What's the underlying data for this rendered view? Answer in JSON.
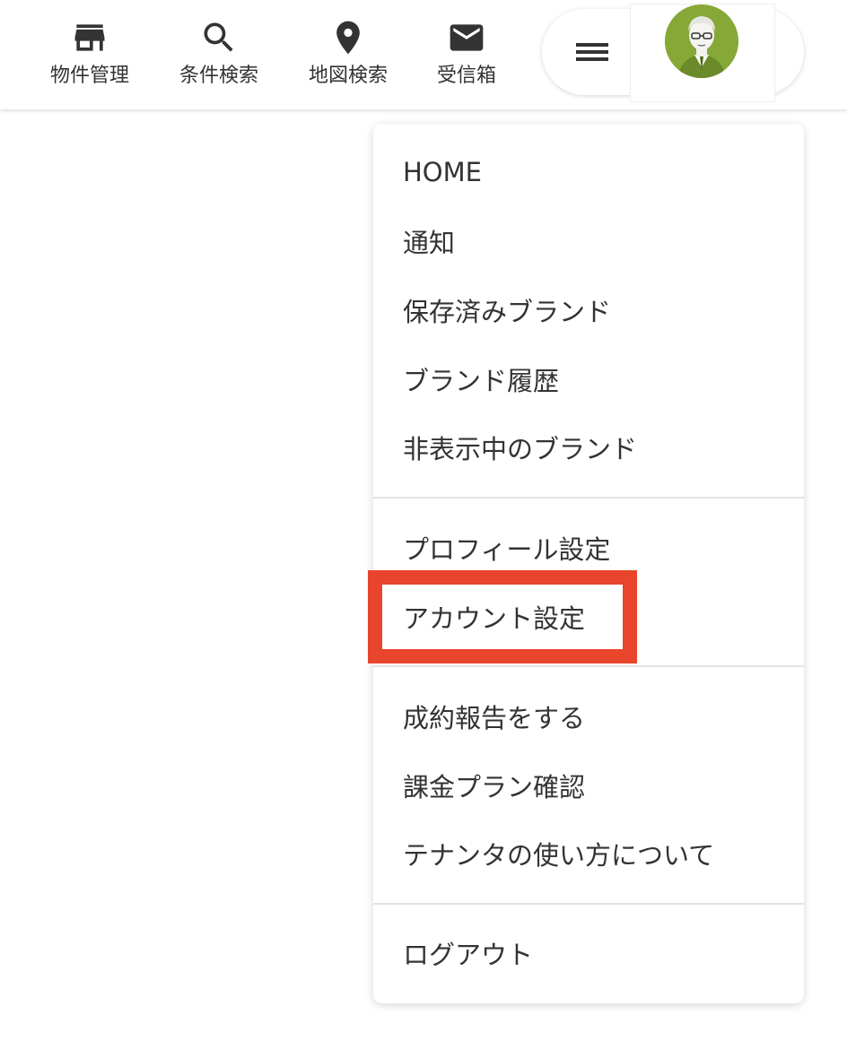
{
  "top_nav": {
    "items": [
      {
        "label": "物件管理",
        "icon": "store-icon"
      },
      {
        "label": "条件検索",
        "icon": "search-icon"
      },
      {
        "label": "地図検索",
        "icon": "location-pin-icon"
      },
      {
        "label": "受信箱",
        "icon": "mail-icon"
      }
    ]
  },
  "user_menu": {
    "menu_icon": "hamburger-menu-icon",
    "avatar_icon": "user-avatar-illustration"
  },
  "dropdown": {
    "group1": [
      "HOME",
      "通知",
      "保存済みブランド",
      "ブランド履歴",
      "非表示中のブランド"
    ],
    "group2": [
      "プロフィール設定",
      "アカウント設定"
    ],
    "group3": [
      "成約報告をする",
      "課金プラン確認",
      "テナンタの使い方について"
    ],
    "group4": [
      "ログアウト"
    ]
  },
  "colors": {
    "highlight_box": "#e8452c",
    "text": "#333333",
    "avatar_background": "#86a836"
  }
}
